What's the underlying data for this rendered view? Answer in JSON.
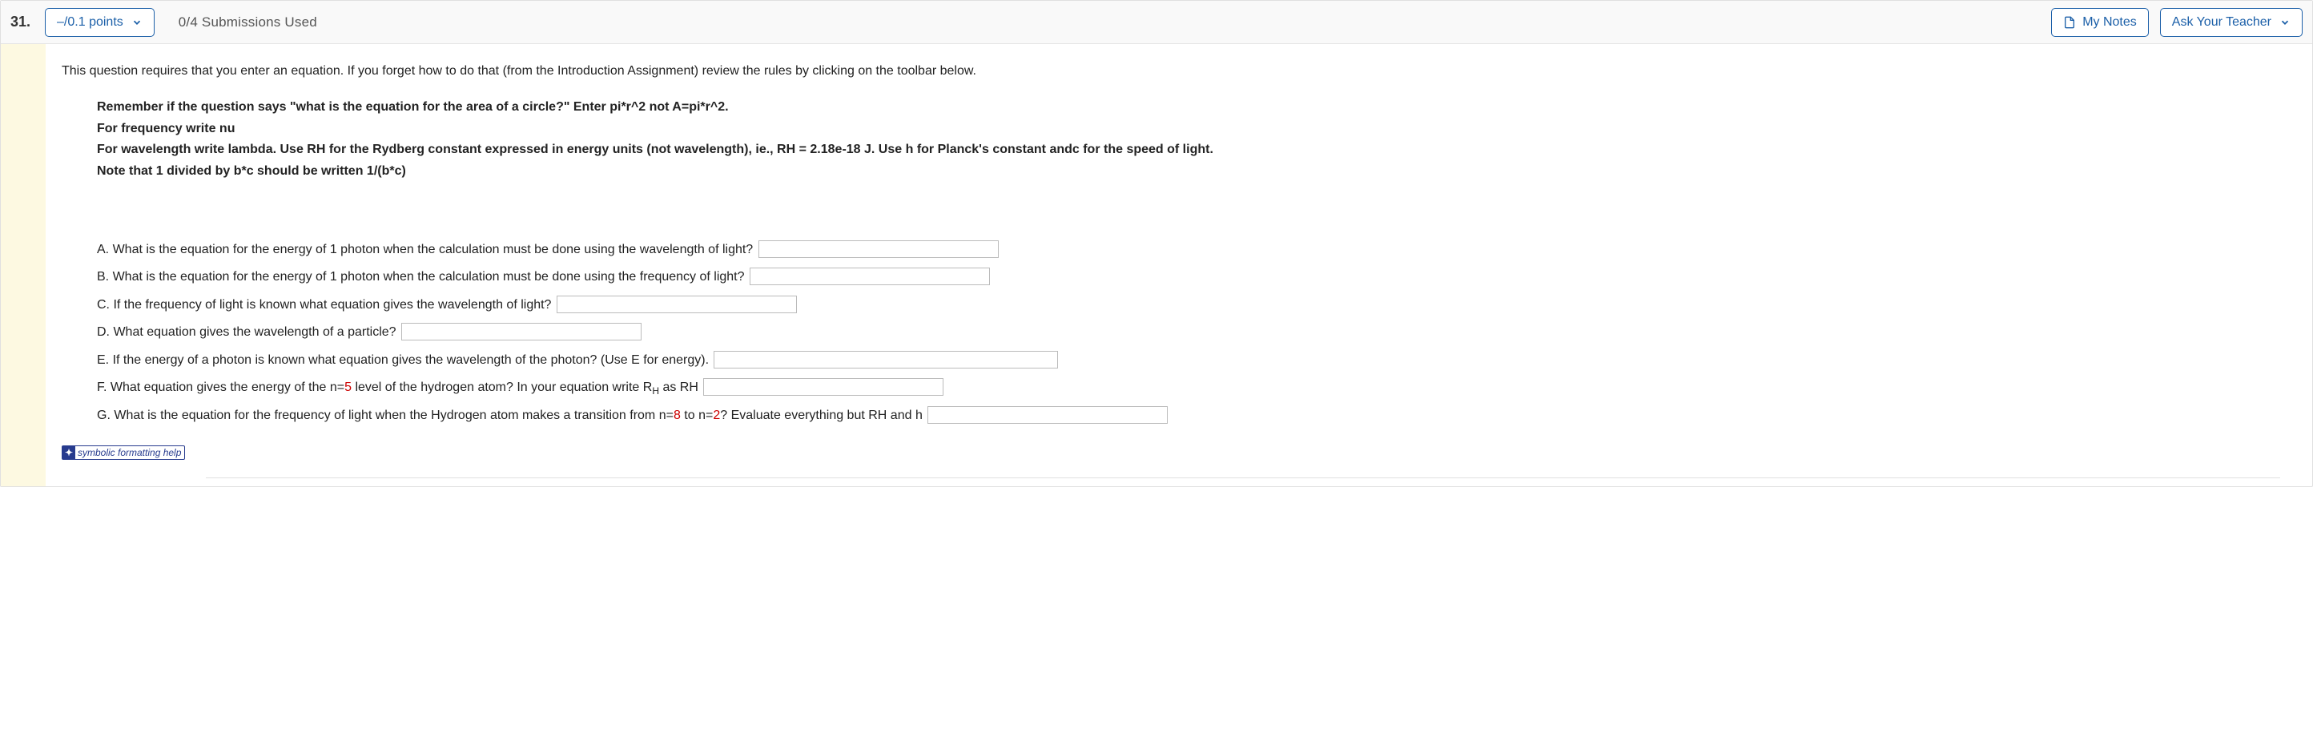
{
  "header": {
    "qnum": "31.",
    "points_label": "–/0.1 points",
    "submissions": "0/4 Submissions Used",
    "my_notes": "My Notes",
    "ask_teacher": "Ask Your Teacher"
  },
  "intro": "This question requires that you enter an equation. If you forget how to do that (from the Introduction Assignment) review the rules by clicking on the toolbar below.",
  "instructions": {
    "line1": "Remember if the question says \"what is the equation for the area of a circle?\" Enter pi*r^2 not A=pi*r^2.",
    "line2": "For frequency write nu",
    "line3": "For wavelength write lambda. Use RH for the Rydberg constant expressed in energy units (not wavelength), ie., RH = 2.18e-18 J. Use h for Planck's constant andc for the speed of light.",
    "line4": "Note that 1 divided by b*c should be written 1/(b*c)"
  },
  "questions": {
    "a": "A. What is the equation for the energy of 1 photon when the calculation must be done using the wavelength of light?",
    "b": "B. What is the equation for the energy of 1 photon when the calculation must be done using the frequency of light?",
    "c": "C. If the frequency of light is known what equation gives the wavelength of light?",
    "d": "D. What equation gives the wavelength of a particle?",
    "e": "E. If the energy of a photon is known what equation gives the wavelength of the photon? (Use E for energy).",
    "f_pre": "F. What equation gives the energy of the n=",
    "f_n": "5",
    "f_mid": " level of the hydrogen atom? In your equation write R",
    "f_sub": "H",
    "f_post": " as RH",
    "g_pre": "G. What is the equation for the frequency of light when the Hydrogen atom makes a transition from n=",
    "g_n1": "8",
    "g_mid": " to n=",
    "g_n2": "2",
    "g_post": "? Evaluate everything but RH and h"
  },
  "symbolic_help": "symbolic formatting help",
  "input_widths": {
    "a": 300,
    "b": 300,
    "c": 300,
    "d": 300,
    "e": 430,
    "f": 300,
    "g": 300
  }
}
